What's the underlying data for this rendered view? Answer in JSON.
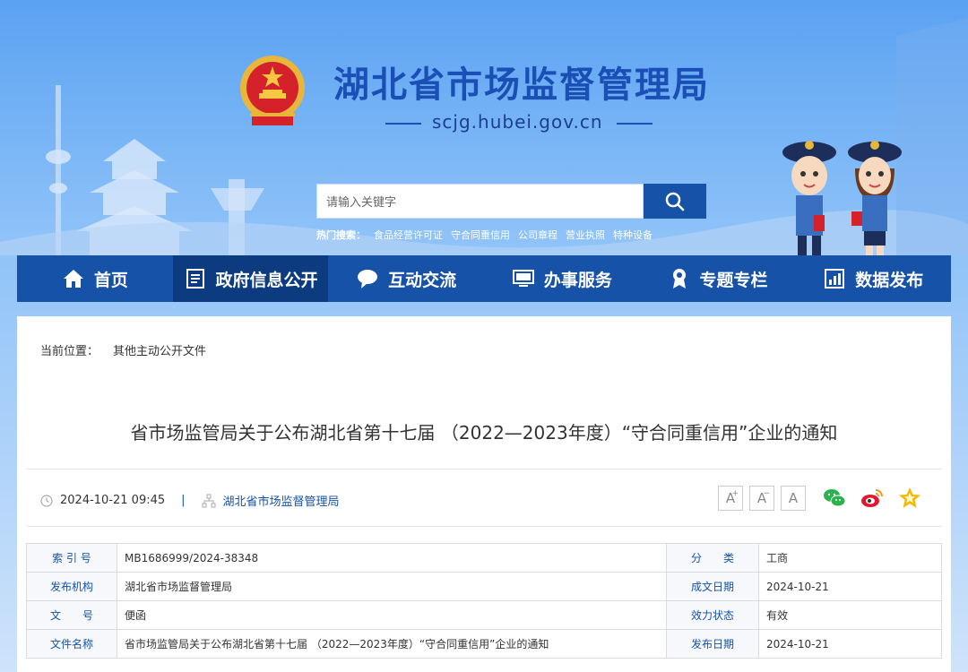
{
  "header": {
    "site_title": "湖北省市场监督管理局",
    "domain": "scjg.hubei.gov.cn",
    "emblem_icon": "national-emblem-icon"
  },
  "search": {
    "placeholder": "请输入关键字",
    "button_icon": "search-icon",
    "hot_label": "热门搜索：",
    "hot_terms": [
      "食品经营许可证",
      "守合同重信用",
      "公司章程",
      "营业执照",
      "特种设备"
    ]
  },
  "nav": {
    "items": [
      {
        "label": "首页",
        "icon": "home-icon"
      },
      {
        "label": "政府信息公开",
        "icon": "document-list-icon"
      },
      {
        "label": "互动交流",
        "icon": "chat-bubble-icon"
      },
      {
        "label": "办事服务",
        "icon": "monitor-icon"
      },
      {
        "label": "专题专栏",
        "icon": "award-icon"
      },
      {
        "label": "数据发布",
        "icon": "bar-chart-icon"
      }
    ],
    "active_index": 1
  },
  "breadcrumb": {
    "label": "当前位置：",
    "current": "其他主动公开文件"
  },
  "article": {
    "title": "省市场监管局关于公布湖北省第十七届 （2022—2023年度）“守合同重信用”企业的通知",
    "datetime": "2024-10-21 09:45",
    "separator": "|",
    "publisher": "湖北省市场监督管理局"
  },
  "font_controls": [
    "A",
    "A",
    "A"
  ],
  "share": [
    "wechat-icon",
    "weibo-icon",
    "favorite-star-icon"
  ],
  "info_table": {
    "rows": [
      {
        "k1": "索 引 号",
        "v1": "MB1686999/2024-38348",
        "k2": "分　　类",
        "v2": "工商"
      },
      {
        "k1": "发布机构",
        "v1": "湖北省市场监督管理局",
        "k2": "成文日期",
        "v2": "2024-10-21"
      },
      {
        "k1": "文　　号",
        "v1": "便函",
        "k2": "效力状态",
        "v2": "有效"
      },
      {
        "k1": "文件名称",
        "v1": "省市场监管局关于公布湖北省第十七届 （2022—2023年度）“守合同重信用”企业的通知",
        "k2": "发布日期",
        "v2": "2024-10-21"
      }
    ]
  },
  "colors": {
    "primary": "#1652a8",
    "nav_active": "#0d3b80",
    "title_blue": "#1a4fb6"
  }
}
